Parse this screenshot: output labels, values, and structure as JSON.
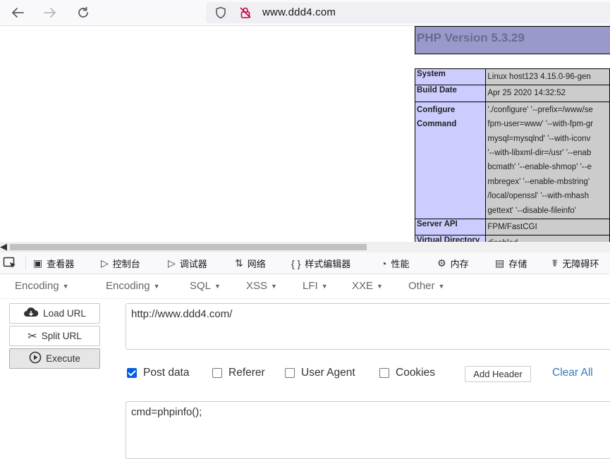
{
  "browser": {
    "url": "www.ddd4.com",
    "icons": [
      "back-arrow-icon",
      "forward-arrow-icon",
      "reload-icon",
      "shield-icon",
      "insecure-lock-icon"
    ]
  },
  "phpinfo": {
    "title": "PHP Version 5.3.29",
    "rows": [
      {
        "key": "System",
        "value": "Linux host123 4.15.0-96-gen"
      },
      {
        "key": "Build Date",
        "value": "Apr 25 2020 14:32:52"
      },
      {
        "key": "Configure Command",
        "key_lines": [
          "Configure",
          "Command"
        ],
        "value_lines": [
          "'./configure' '--prefix=/www/se",
          "fpm-user=www' '--with-fpm-gr",
          "mysql=mysqlnd' '--with-iconv",
          "'--with-libxml-dir=/usr' '--enab",
          "bcmath' '--enable-shmop' '--e",
          "mbregex' '--enable-mbstring'",
          "/local/openssl' '--with-mhash",
          "gettext' '--disable-fileinfo'"
        ]
      },
      {
        "key": "Server API",
        "value": "FPM/FastCGI"
      },
      {
        "key": "Virtual Directory",
        "value": "disabled"
      }
    ]
  },
  "devtools": {
    "tabs": [
      {
        "label": "查看器",
        "icon": "inspector-icon"
      },
      {
        "label": "控制台",
        "icon": "console-icon"
      },
      {
        "label": "调试器",
        "icon": "debugger-icon"
      },
      {
        "label": "网络",
        "icon": "network-icon"
      },
      {
        "label": "样式编辑器",
        "icon": "style-editor-icon"
      },
      {
        "label": "性能",
        "icon": "performance-icon"
      },
      {
        "label": "内存",
        "icon": "memory-icon"
      },
      {
        "label": "存储",
        "icon": "storage-icon"
      },
      {
        "label": "无障碍环",
        "icon": "accessibility-icon"
      }
    ]
  },
  "hackbar": {
    "menu": [
      "Encoding",
      "Encoding",
      "SQL",
      "XSS",
      "LFI",
      "XXE",
      "Other"
    ],
    "load_url": "Load URL",
    "split_url": "Split URL",
    "execute": "Execute",
    "url_value": "http://www.ddd4.com/",
    "options": {
      "post_data": "Post data",
      "referer": "Referer",
      "user_agent": "User Agent",
      "cookies": "Cookies",
      "post_data_checked": true,
      "referer_checked": false,
      "user_agent_checked": false,
      "cookies_checked": false
    },
    "add_header": "Add Header",
    "clear_all": "Clear All",
    "post_value": "cmd=phpinfo();"
  },
  "colors": {
    "php_header": "#9999cc",
    "php_key": "#ccccff",
    "php_value": "#cccccc",
    "link_blue": "#337ab7",
    "checkbox_blue": "#0060df"
  }
}
